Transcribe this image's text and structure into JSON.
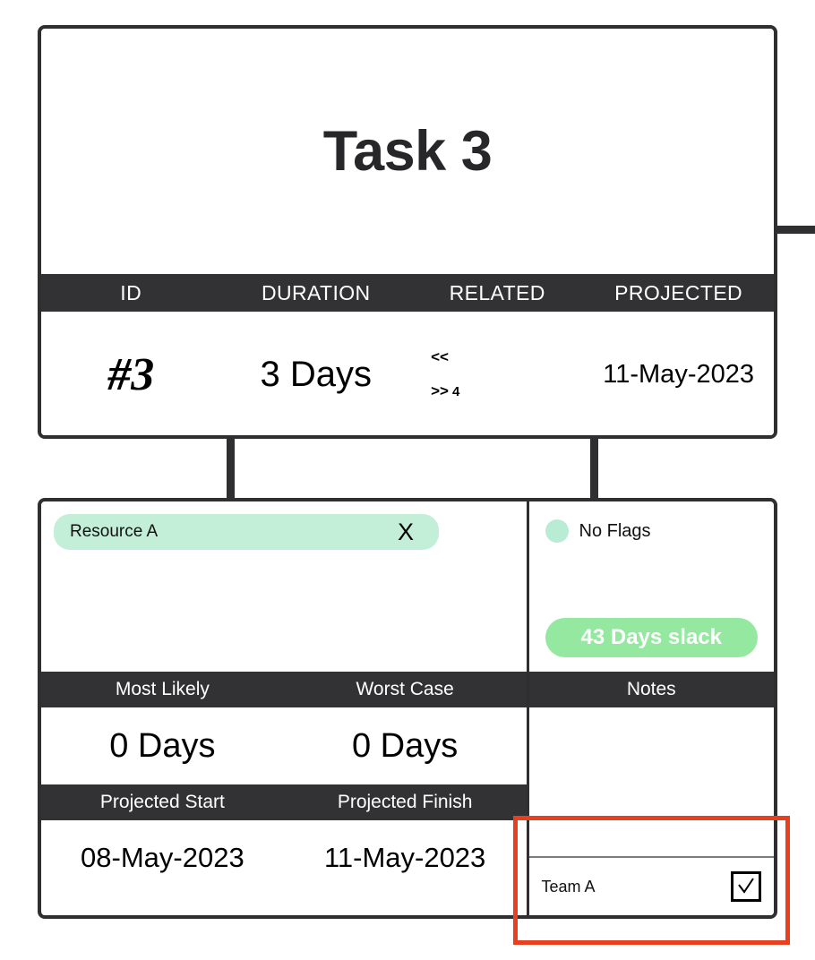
{
  "task_card": {
    "title": "Task 3",
    "columns": [
      "ID",
      "DURATION",
      "RELATED",
      "PROJECTED"
    ],
    "values": {
      "id": "#3",
      "duration": "3 Days",
      "projected": "11-May-2023"
    },
    "related": {
      "predecessors_symbol": "<<",
      "predecessors_count": "",
      "successors_symbol": ">>",
      "successors_count": "4"
    }
  },
  "detail_card": {
    "resources": [
      {
        "name": "Resource A",
        "remove_label": "X"
      }
    ],
    "flags": {
      "status_label": "No Flags",
      "status_dot_color": "#b8ecd5"
    },
    "slack": {
      "label": "43 Days slack",
      "color": "#94e8a0"
    },
    "estimates": {
      "headers": [
        "Most Likely",
        "Worst Case"
      ],
      "values": [
        "0 Days",
        "0 Days"
      ]
    },
    "schedule": {
      "headers": [
        "Projected Start",
        "Projected Finish"
      ],
      "values": [
        "08-May-2023",
        "11-May-2023"
      ]
    },
    "notes": {
      "header": "Notes",
      "items": [
        {
          "label": "Team A",
          "checked": true
        }
      ]
    }
  },
  "highlight": {
    "color": "#e8401f"
  }
}
